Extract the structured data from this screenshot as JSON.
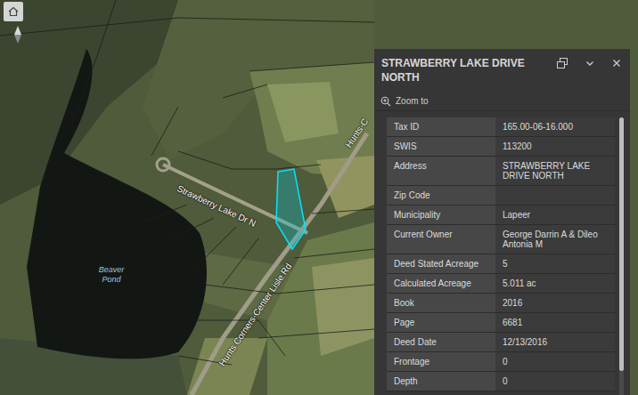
{
  "map": {
    "labels": [
      {
        "text": "Strawberry Lake Dr N"
      },
      {
        "text": "Hunts Corners-Center Lisle Rd"
      },
      {
        "text": "Hunts-C"
      },
      {
        "text": "Beaver Pond"
      }
    ]
  },
  "popup": {
    "title": "STRAWBERRY LAKE DRIVE NORTH",
    "zoom": "Zoom to",
    "fields": [
      {
        "label": "Tax ID",
        "value": "165.00-06-16.000"
      },
      {
        "label": "SWIS",
        "value": "113200"
      },
      {
        "label": "Address",
        "value": "STRAWBERRY LAKE DRIVE NORTH"
      },
      {
        "label": "Zip Code",
        "value": ""
      },
      {
        "label": "Municipality",
        "value": "Lapeer"
      },
      {
        "label": "Current Owner",
        "value": "George Darrin A & Dileo Antonia M"
      },
      {
        "label": "Deed Stated Acreage",
        "value": "5"
      },
      {
        "label": "Calculated Acreage",
        "value": "5.011 ac"
      },
      {
        "label": "Book",
        "value": "2016"
      },
      {
        "label": "Page",
        "value": "6681"
      },
      {
        "label": "Deed Date",
        "value": "12/13/2016"
      },
      {
        "label": "Frontage",
        "value": "0"
      },
      {
        "label": "Depth",
        "value": "0"
      }
    ]
  }
}
